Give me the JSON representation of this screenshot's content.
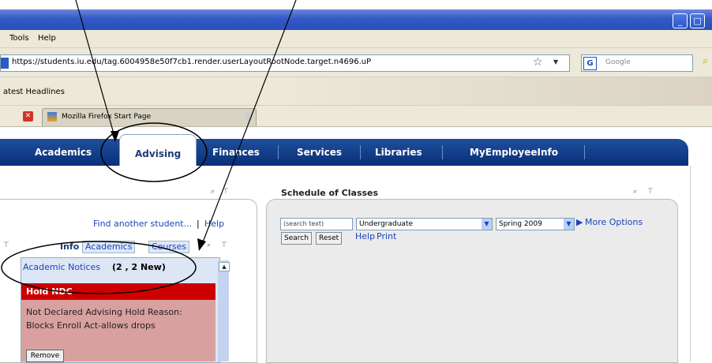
{
  "window": {
    "controls": {
      "minimize": "_",
      "maximize": "□"
    }
  },
  "menu": {
    "items": [
      "Tools",
      "Help"
    ]
  },
  "toolbar": {
    "url": "https://students.iu.edu/tag.6004958e50f7cb1.render.userLayoutRootNode.target.n4696.uP",
    "search_placeholder": "Google",
    "search_engine_icon": "G"
  },
  "bookmarks": {
    "label": "atest Headlines"
  },
  "browser_tab": {
    "label": "Mozilla Firefox Start Page"
  },
  "portal_nav": {
    "tabs": [
      "Academics",
      "Advising",
      "Finances",
      "Services",
      "Libraries",
      "MyEmployeeInfo"
    ],
    "active": "Advising"
  },
  "left_panel": {
    "find_link": "Find another student...",
    "separator": "|",
    "help_link": "Help",
    "subtabs": [
      "Info",
      "Academics",
      "Courses"
    ],
    "notices_label": "Academic Notices",
    "notices_count": "(2 , 2 New)",
    "hold_title": "Hold NDC",
    "hold_text": "Not Declared Advising Hold Reason: Blocks Enroll Act-allows drops",
    "remove_button": "Remove"
  },
  "schedule": {
    "title": "Schedule of Classes",
    "search_placeholder": "(search text)",
    "career_value": "Undergraduate",
    "term_value": "Spring 2009",
    "more_options": "More Options",
    "search_button": "Search",
    "reset_button": "Reset",
    "help_link": "Help",
    "print_link": "Print"
  },
  "colors": {
    "titlebar": "#3359c7",
    "nav_bar": "#0a2f78",
    "hold_header": "#cc0000",
    "hold_body": "#d9a0a0",
    "link": "#1b45b8"
  }
}
